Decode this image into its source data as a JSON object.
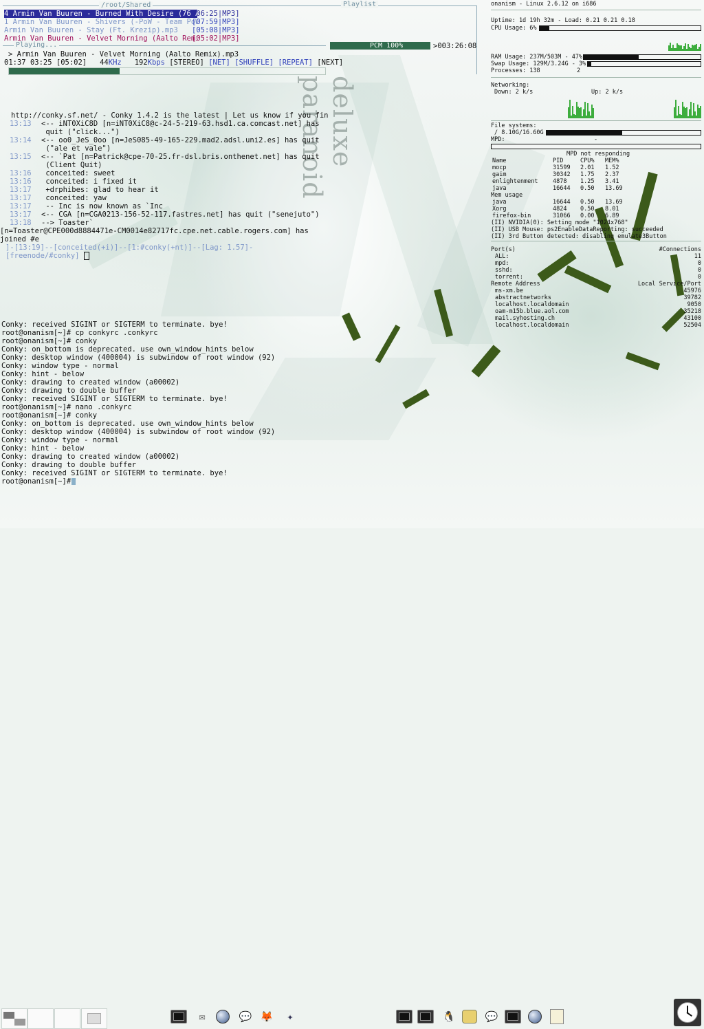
{
  "playlist": {
    "title": "/root/Shared",
    "right_title": "Playlist",
    "rows": [
      {
        "text": "4 Armin Van Buuren - Burned With Desire (76 A",
        "time": "[06:25|MP3]",
        "style": "selected"
      },
      {
        "text": "1 Armin Van Buuren - Shivers (-PoW - Team PoW",
        "time": "[07:59|MP3]",
        "style": "dim"
      },
      {
        "text": "Armin Van Buuren - Stay (Ft. Krezip).mp3",
        "time": "[05:08|MP3]",
        "style": "dim"
      },
      {
        "text": "Armin Van Buuren - Velvet Morning (Aalto Remi",
        "time": "[05:02|MP3]",
        "style": "active"
      }
    ]
  },
  "playing": {
    "title": "Playing...",
    "pcm": "PCM 100%",
    "remaining": ">003:26:08",
    "track": "> Armin Van Buuren - Velvet Morning (Aalto Remix).mp3",
    "elapsed": "01:37",
    "total": "03:25",
    "length": "[05:02]",
    "khz": "44",
    "khz_unit": "KHz",
    "kbps": "192",
    "kbps_unit": "Kbps",
    "stereo": "[STEREO]",
    "net": "[NET]",
    "shuffle": "[SHUFFLE]",
    "repeat": "[REPEAT]",
    "next": "[NEXT]",
    "progress": 0.35
  },
  "irc": {
    "topic": "http://conky.sf.net/ - Conky 1.4.2 is the latest | Let us know if you fin",
    "lines": [
      {
        "time": "13:13",
        "text": "<-- iNT0XiC8D [n=iNT0XiC8@c-24-5-219-63.hsd1.ca.comcast.net] has"
      },
      {
        "time": "",
        "text": "    quit (\"click...\")"
      },
      {
        "time": "13:14",
        "text": "<-- oo0_JeS_0oo [n=JeS085-49-165-229.mad2.adsl.uni2.es] has quit"
      },
      {
        "time": "",
        "text": "    (\"ale et vale\")"
      },
      {
        "time": "13:15",
        "text": "<-- `Pat [n=Patrick@cpe-70-25.fr-dsl.bris.onthenet.net] has quit"
      },
      {
        "time": "",
        "text": "    (Client Quit)"
      },
      {
        "time": "13:16",
        "text": " conceited: sweet"
      },
      {
        "time": "13:16",
        "text": " conceited: i fixed it"
      },
      {
        "time": "13:17",
        "text": " +drphibes: glad to hear it"
      },
      {
        "time": "13:17",
        "text": " conceited: yaw"
      },
      {
        "time": "13:17",
        "text": " -- Inc is now known as `Inc"
      },
      {
        "time": "13:17",
        "text": "<-- CGA [n=CGA0213-156-52-117.fastres.net] has quit (\"senejuto\")"
      },
      {
        "time": "13:18",
        "text": "--> Toaster`"
      }
    ],
    "join_line": "[n=Toaster@CPE000d8884471e-CM0014e82717fc.cpe.net.cable.rogers.com] has",
    "join_line2": "    joined #e",
    "status": "]-[13:19]--[conceited(+i)]--[1:#conky(+nt)]--[Lag: 1.57]-",
    "channel": "[freenode/#conky]"
  },
  "terminal": {
    "lines": [
      "Conky: received SIGINT or SIGTERM to terminate. bye!",
      "root@onanism[~]# cp conkyrc .conkyrc",
      "root@onanism[~]# conky",
      "Conky: on_bottom is deprecated.  use own_window_hints below",
      "Conky: desktop window (400004) is subwindow of root window (92)",
      "Conky: window type - normal",
      "Conky: hint - below",
      "Conky: drawing to created window (a00002)",
      "Conky: drawing to double buffer",
      "Conky: received SIGINT or SIGTERM to terminate. bye!",
      "root@onanism[~]# nano .conkyrc",
      "root@onanism[~]# conky",
      "Conky: on_bottom is deprecated.  use own_window_hints below",
      "Conky: desktop window (400004) is subwindow of root window (92)",
      "Conky: window type - normal",
      "Conky: hint - below",
      "Conky: drawing to created window (a00002)",
      "Conky: drawing to double buffer",
      "Conky: received SIGINT or SIGTERM to terminate. bye!",
      "root@onanism[~]#"
    ]
  },
  "wallpaper_text": "deluxe paranoid",
  "conky": {
    "header": "onanism - Linux 2.6.12 on i686",
    "uptime": "Uptime: 1d 19h 32m - Load: 0.21 0.21 0.18",
    "cpu": "CPU Usage: 6%",
    "cpu_value": 0.06,
    "ram": "RAM Usage: 237M/503M - 47%",
    "ram_value": 0.47,
    "swap": "Swap Usage: 129M/3.24G - 3%",
    "swap_value": 0.03,
    "processes": "Processes: 138",
    "running": "2",
    "networking": "Networking:",
    "down": "Down: 2 k/s",
    "up": "Up: 2 k/s",
    "fs_title": "File systems:",
    "fs_root": "/ 8.10G/16.60G",
    "fs_value": 0.49,
    "mpd_label": "MPD:",
    "mpd_dash": "-",
    "mpd_status": "MPD not responding",
    "top_headers": [
      "Name",
      "PID",
      "CPU%",
      "MEM%"
    ],
    "top_cpu": [
      [
        "mocp",
        "31599",
        "2.01",
        "1.52"
      ],
      [
        "gaim",
        "30342",
        "1.75",
        "2.37"
      ],
      [
        "enlightenment",
        "4878",
        "1.25",
        "3.41"
      ],
      [
        "java",
        "16644",
        "0.50",
        "13.69"
      ]
    ],
    "mem_title": "Mem usage",
    "top_mem": [
      [
        "java",
        "16644",
        "0.50",
        "13.69"
      ],
      [
        "Xorg",
        "4824",
        "0.50",
        "8.01"
      ],
      [
        "firefox-bin",
        "31066",
        "0.00",
        "6.89"
      ]
    ],
    "log": [
      "(II) NVIDIA(0): Setting mode \"1024x768\"",
      "(II) USB Mouse: ps2EnableDataReporting: succeeded",
      "(II) 3rd Button detected: disabling emulate3Button"
    ],
    "ports_title": "Port(s)",
    "connections_title": "#Connections",
    "ports": [
      [
        "ALL:",
        "11"
      ],
      [
        "mpd:",
        "0"
      ],
      [
        "sshd:",
        "0"
      ],
      [
        "torrent:",
        "0"
      ]
    ],
    "remote_title": "Remote Address",
    "local_title": "Local Service/Port",
    "remotes": [
      [
        "ms-xm.be",
        "45976"
      ],
      [
        "abstractnetworks",
        "39782"
      ],
      [
        "localhost.localdomain",
        "9050"
      ],
      [
        "oam-m15b.blue.aol.com",
        "35218"
      ],
      [
        "mail.syhosting.ch",
        "43100"
      ],
      [
        "localhost.localdomain",
        "52504"
      ]
    ]
  },
  "colors": {
    "selected_bg": "#2a2a9a",
    "active": "#a0105a",
    "dim": "#7d95c8",
    "blue": "#3344bb",
    "accent": "#2f6b4c",
    "graph": "#3dad3d"
  },
  "taskbar": {
    "icons": [
      "terminal-icon",
      "mail-icon",
      "browser-icon",
      "chat-icon",
      "gimp-icon",
      "xchat-icon"
    ],
    "right_icons": [
      "terminal-icon",
      "terminal-icon",
      "tux-icon",
      "gaim-icon",
      "xchat-icon",
      "terminal-icon",
      "browser-icon",
      "notes-icon"
    ]
  }
}
